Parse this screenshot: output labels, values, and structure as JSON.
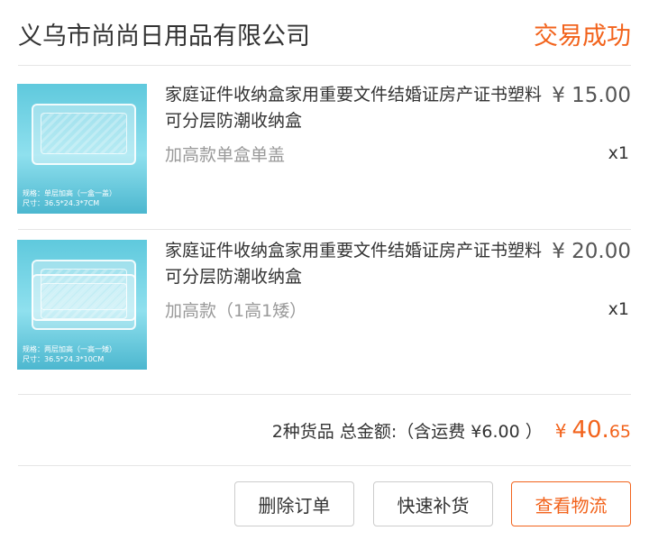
{
  "header": {
    "shop_name": "义乌市尚尚日用品有限公司",
    "status": "交易成功"
  },
  "items": [
    {
      "title": "家庭证件收纳盒家用重要文件结婚证房产证书塑料可分层防潮收纳盒",
      "variant": "加高款单盒单盖",
      "price": "¥ 15.00",
      "quantity": "x1",
      "image_text_1": "规格：单层加高（一盒一盖）",
      "image_text_2": "尺寸：36.5*24.3*7CM"
    },
    {
      "title": "家庭证件收纳盒家用重要文件结婚证房产证书塑料可分层防潮收纳盒",
      "variant": "加高款（1高1矮）",
      "price": "¥ 20.00",
      "quantity": "x1",
      "image_text_1": "规格：两层加高（一高一矮）",
      "image_text_2": "尺寸：36.5*24.3*10CM"
    }
  ],
  "summary": {
    "text": "2种货品 总金额:（含运费 ¥6.00 ）",
    "currency": "¥",
    "amount_int": "40.",
    "amount_dec": "65"
  },
  "actions": {
    "delete": "删除订单",
    "restock": "快速补货",
    "logistics": "查看物流"
  },
  "colors": {
    "accent": "#f2631c",
    "text": "#333333",
    "muted": "#999999"
  }
}
